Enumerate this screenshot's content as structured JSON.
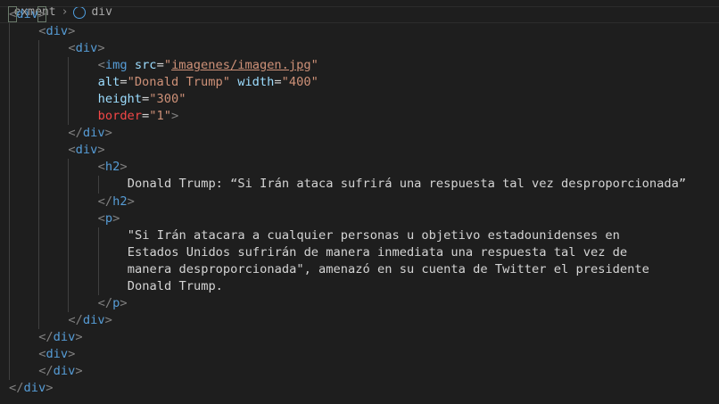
{
  "breadcrumb": {
    "items": [
      "exment",
      "div"
    ]
  },
  "colors": {
    "background": "#1e1e1e",
    "tag": "#569cd6",
    "attribute": "#9cdcfe",
    "string": "#ce9178",
    "bracket": "#808080",
    "text": "#d4d4d4",
    "error_attr": "#f44747"
  },
  "lines": [
    {
      "indent": 0,
      "current": true,
      "tokens": [
        {
          "t": "pm",
          "v": "<"
        },
        {
          "t": "tag",
          "v": "div"
        },
        {
          "t": "pm",
          "v": ">"
        }
      ]
    },
    {
      "indent": 1,
      "tokens": [
        {
          "t": "punc",
          "v": "<"
        },
        {
          "t": "tag",
          "v": "div"
        },
        {
          "t": "punc",
          "v": ">"
        }
      ]
    },
    {
      "indent": 2,
      "tokens": [
        {
          "t": "punc",
          "v": "<"
        },
        {
          "t": "tag",
          "v": "div"
        },
        {
          "t": "punc",
          "v": ">"
        }
      ]
    },
    {
      "indent": 3,
      "tokens": [
        {
          "t": "punc",
          "v": "<"
        },
        {
          "t": "tag",
          "v": "img"
        },
        {
          "t": "text",
          "v": " "
        },
        {
          "t": "attr",
          "v": "src"
        },
        {
          "t": "text",
          "v": "="
        },
        {
          "t": "str",
          "v": "\""
        },
        {
          "t": "link",
          "v": "imagenes/imagen.jpg"
        },
        {
          "t": "str",
          "v": "\""
        }
      ]
    },
    {
      "indent": 3,
      "tokens": [
        {
          "t": "attr",
          "v": "alt"
        },
        {
          "t": "text",
          "v": "="
        },
        {
          "t": "str",
          "v": "\"Donald Trump\""
        },
        {
          "t": "text",
          "v": " "
        },
        {
          "t": "attr",
          "v": "width"
        },
        {
          "t": "text",
          "v": "="
        },
        {
          "t": "str",
          "v": "\"400\""
        }
      ]
    },
    {
      "indent": 3,
      "tokens": [
        {
          "t": "attr",
          "v": "height"
        },
        {
          "t": "text",
          "v": "="
        },
        {
          "t": "str",
          "v": "\"300\""
        }
      ]
    },
    {
      "indent": 3,
      "tokens": [
        {
          "t": "red",
          "v": "border"
        },
        {
          "t": "text",
          "v": "="
        },
        {
          "t": "str",
          "v": "\"1\""
        },
        {
          "t": "punc",
          "v": ">"
        }
      ]
    },
    {
      "indent": 2,
      "tokens": [
        {
          "t": "punc",
          "v": "</"
        },
        {
          "t": "tag",
          "v": "div"
        },
        {
          "t": "punc",
          "v": ">"
        }
      ]
    },
    {
      "indent": 2,
      "tokens": [
        {
          "t": "punc",
          "v": "<"
        },
        {
          "t": "tag",
          "v": "div"
        },
        {
          "t": "punc",
          "v": ">"
        }
      ]
    },
    {
      "indent": 3,
      "tokens": [
        {
          "t": "punc",
          "v": "<"
        },
        {
          "t": "tag",
          "v": "h2"
        },
        {
          "t": "punc",
          "v": ">"
        }
      ]
    },
    {
      "indent": 4,
      "tokens": [
        {
          "t": "text",
          "v": "Donald Trump: “Si Irán ataca sufrirá una respuesta tal vez desproporcionada”"
        }
      ]
    },
    {
      "indent": 3,
      "tokens": [
        {
          "t": "punc",
          "v": "</"
        },
        {
          "t": "tag",
          "v": "h2"
        },
        {
          "t": "punc",
          "v": ">"
        }
      ]
    },
    {
      "indent": 3,
      "tokens": [
        {
          "t": "punc",
          "v": "<"
        },
        {
          "t": "tag",
          "v": "p"
        },
        {
          "t": "punc",
          "v": ">"
        }
      ]
    },
    {
      "indent": 4,
      "tokens": [
        {
          "t": "text",
          "v": "\"Si Irán atacara a cualquier personas u objetivo estadounidenses en"
        }
      ]
    },
    {
      "indent": 4,
      "tokens": [
        {
          "t": "text",
          "v": "Estados Unidos sufrirán de manera inmediata una respuesta tal vez de"
        }
      ]
    },
    {
      "indent": 4,
      "tokens": [
        {
          "t": "text",
          "v": "manera desproporcionada\", amenazó en su cuenta de Twitter el presidente"
        }
      ]
    },
    {
      "indent": 4,
      "tokens": [
        {
          "t": "text",
          "v": "Donald Trump."
        }
      ]
    },
    {
      "indent": 3,
      "tokens": [
        {
          "t": "punc",
          "v": "</"
        },
        {
          "t": "tag",
          "v": "p"
        },
        {
          "t": "punc",
          "v": ">"
        }
      ]
    },
    {
      "indent": 2,
      "tokens": [
        {
          "t": "punc",
          "v": "</"
        },
        {
          "t": "tag",
          "v": "div"
        },
        {
          "t": "punc",
          "v": ">"
        }
      ]
    },
    {
      "indent": 1,
      "tokens": [
        {
          "t": "punc",
          "v": "</"
        },
        {
          "t": "tag",
          "v": "div"
        },
        {
          "t": "punc",
          "v": ">"
        }
      ]
    },
    {
      "indent": 1,
      "tokens": [
        {
          "t": "punc",
          "v": "<"
        },
        {
          "t": "tag",
          "v": "div"
        },
        {
          "t": "punc",
          "v": ">"
        }
      ]
    },
    {
      "indent": 1,
      "tokens": [
        {
          "t": "punc",
          "v": "</"
        },
        {
          "t": "tag",
          "v": "div"
        },
        {
          "t": "punc",
          "v": ">"
        }
      ]
    },
    {
      "indent": 0,
      "tokens": [
        {
          "t": "punc",
          "v": "</"
        },
        {
          "t": "tag",
          "v": "div"
        },
        {
          "t": "punc",
          "v": ">"
        }
      ]
    }
  ]
}
